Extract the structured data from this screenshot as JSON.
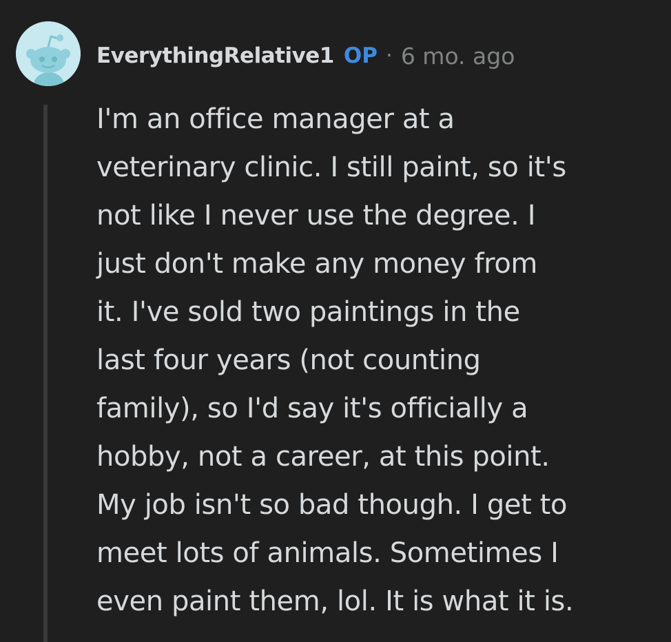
{
  "comment": {
    "username": "EverythingRelative1",
    "badge": "OP",
    "separator": "·",
    "timestamp": "6 mo. ago",
    "avatar_icon": "reddit-snoo-avatar-icon",
    "avatar_color": "#c7e9ef",
    "accent_color": "#3f8ae0",
    "body_lines": [
      "I'm an office manager at a",
      "veterinary clinic. I still paint, so it's",
      "not like I never use the degree. I",
      "just don't make any money from",
      "it. I've sold two paintings in the",
      "last four years (not counting",
      "family), so I'd say it's officially a",
      "hobby, not a career, at this point.",
      "My job isn't so bad though. I get to",
      "meet lots of animals. Sometimes I",
      "even paint them, lol. It is what it is."
    ]
  }
}
